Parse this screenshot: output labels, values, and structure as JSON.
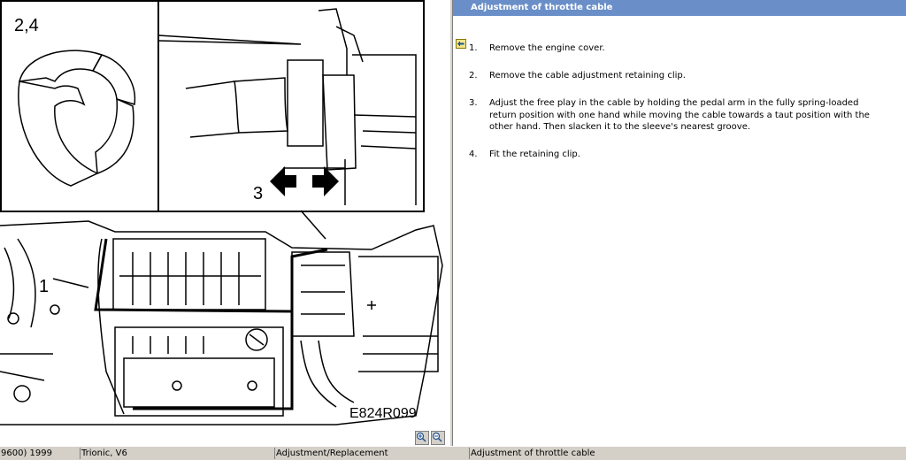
{
  "figure": {
    "callout_top_left": "2,4",
    "callout_arrow": "3",
    "callout_engine": "1",
    "figure_code": "E824R099"
  },
  "header": {
    "title": "Adjustment of throttle cable"
  },
  "steps": [
    {
      "num": "1.",
      "lines": [
        "Remove the engine cover."
      ]
    },
    {
      "num": "2.",
      "lines": [
        "Remove the cable adjustment retaining clip."
      ]
    },
    {
      "num": "3.",
      "lines": [
        "Adjust the free play in the cable by holding the pedal arm in the fully spring-loaded",
        "return position with one hand while moving the cable towards a taut position with the",
        "other hand. Then slacken it to the sleeve's nearest groove."
      ]
    },
    {
      "num": "4.",
      "lines": [
        "Fit the retaining clip."
      ]
    }
  ],
  "status_bar": {
    "model": "9600) 1999",
    "engine": "Trionic, V6",
    "category": "Adjustment/Replacement",
    "topic": "Adjustment of throttle cable"
  },
  "icons": {
    "zoom_in": "magnifier-plus-icon",
    "zoom_out": "magnifier-minus-icon",
    "back": "back-arrow-icon"
  },
  "colors": {
    "header_bg": "#6a8fc8",
    "status_bg": "#d4d0c8"
  }
}
